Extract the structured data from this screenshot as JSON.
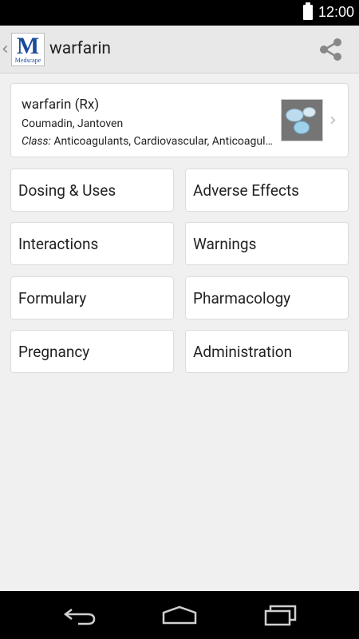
{
  "status_bar": {
    "time": "12:00"
  },
  "header": {
    "logo_letter": "M",
    "logo_word": "Medscape",
    "title": "warfarin"
  },
  "drug_card": {
    "name": "warfarin (Rx)",
    "brands": "Coumadin, Jantoven",
    "class_label": "Class:",
    "class_value": " Anticoagulants, Cardiovascular, Anticoagulants"
  },
  "tiles": [
    {
      "label": "Dosing & Uses"
    },
    {
      "label": "Adverse Effects"
    },
    {
      "label": "Interactions"
    },
    {
      "label": "Warnings"
    },
    {
      "label": "Formulary"
    },
    {
      "label": "Pharmacology"
    },
    {
      "label": "Pregnancy"
    },
    {
      "label": "Administration"
    }
  ],
  "icons": {
    "battery": "battery-icon",
    "up": "back-arrow-icon",
    "share": "share-icon",
    "chevron": "chevron-right-icon",
    "nav_back": "nav-back-icon",
    "nav_home": "nav-home-icon",
    "nav_recents": "nav-recents-icon"
  },
  "colors": {
    "brand_blue": "#1a4b9b",
    "action_bar": "#e8e8e8",
    "background": "#f0f0f0"
  }
}
